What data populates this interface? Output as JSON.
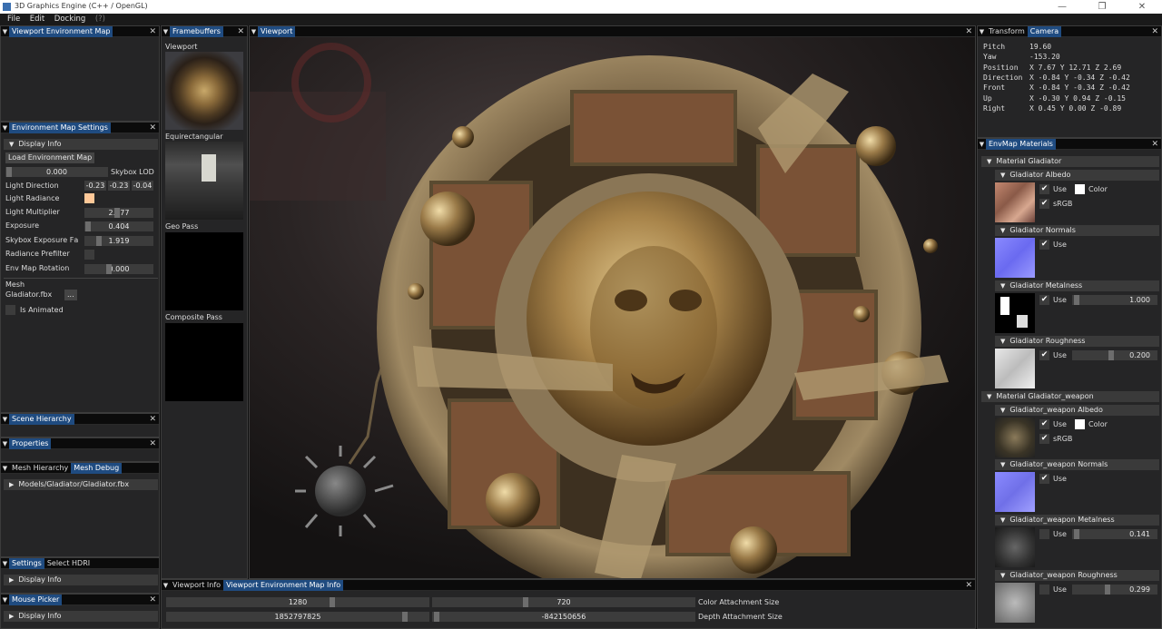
{
  "window": {
    "title": "3D Graphics Engine (C++ / OpenGL)",
    "minimize": "—",
    "restore": "❐",
    "close": "✕"
  },
  "menu": {
    "file": "File",
    "edit": "Edit",
    "docking": "Docking",
    "help": "(?)"
  },
  "env_map_panel": {
    "title": "Viewport Environment Map"
  },
  "env_settings": {
    "title": "Environment Map Settings",
    "display_info": "Display Info",
    "load_button": "Load Environment Map",
    "skybox_lod_value": "0.000",
    "skybox_lod_label": "Skybox LOD",
    "light_direction_label": "Light Direction",
    "light_direction_values": [
      "-0.23",
      "-0.23",
      "-0.04"
    ],
    "light_radiance_label": "Light Radiance",
    "light_radiance_color": "#ffc898",
    "light_multiplier_label": "Light Multiplier",
    "light_multiplier_value": "2.677",
    "exposure_label": "Exposure",
    "exposure_value": "0.404",
    "skybox_exposure_label": "Skybox Exposure Fа",
    "skybox_exposure_value": "1.919",
    "radiance_prefilter_label": "Radiance Prefilter",
    "env_rotation_label": "Env Map Rotation",
    "env_rotation_value": "0.000",
    "mesh_label": "Mesh",
    "mesh_file": "Gladiator.fbx",
    "mesh_browse": "...",
    "is_animated_label": "Is Animated"
  },
  "scene_hierarchy": {
    "title": "Scene Hierarchy"
  },
  "properties": {
    "title": "Properties"
  },
  "mesh_panel": {
    "tab1": "Mesh Hierarchy",
    "tab2": "Mesh Debug",
    "item": "Models/Gladiator/Gladiator.fbx"
  },
  "settings_panel": {
    "tab1": "Settings",
    "tab2": "Select HDRI",
    "display_info": "Display Info"
  },
  "mouse_picker": {
    "title": "Mouse Picker",
    "display_info": "Display Info"
  },
  "framebuffers": {
    "title": "Framebuffers",
    "viewport": "Viewport",
    "equirect": "Equirectangular",
    "geo": "Geo Pass",
    "composite": "Composite Pass"
  },
  "viewport": {
    "title": "Viewport"
  },
  "info_panel": {
    "tab1": "Viewport Info",
    "tab2": "Viewport Environment Map Info",
    "color_w": "1280",
    "color_h": "720",
    "color_label": "Color Attachment Size",
    "depth_w": "1852797825",
    "depth_h": "-842150656",
    "depth_label": "Depth Attachment Size"
  },
  "transform": {
    "tab1": "Transform",
    "tab2": "Camera",
    "rows": [
      {
        "label": "Pitch",
        "value": "19.60"
      },
      {
        "label": "Yaw",
        "value": "-153.20"
      },
      {
        "label": "Position",
        "value": "X 7.67 Y 12.71 Z 2.69"
      },
      {
        "label": "Direction",
        "value": "X -0.84 Y -0.34 Z -0.42"
      },
      {
        "label": "Front",
        "value": "X -0.84 Y -0.34 Z -0.42"
      },
      {
        "label": "Up",
        "value": "X -0.30 Y 0.94 Z -0.15"
      },
      {
        "label": "Right",
        "value": "X 0.45 Y 0.00 Z -0.89"
      }
    ]
  },
  "materials": {
    "title": "EnvMap Materials",
    "mat1": "Material Gladiator",
    "albedo": "Gladiator Albedo",
    "normals": "Gladiator Normals",
    "metalness": "Gladiator Metalness",
    "roughness": "Gladiator Roughness",
    "metal_value": "1.000",
    "rough_value": "0.200",
    "mat2": "Material Gladiator_weapon",
    "w_albedo": "Gladiator_weapon Albedo",
    "w_normals": "Gladiator_weapon Normals",
    "w_metalness": "Gladiator_weapon Metalness",
    "w_roughness": "Gladiator_weapon Roughness",
    "w_metal_value": "0.141",
    "w_rough_value": "0.299",
    "use": "Use",
    "color": "Color",
    "srgb": "sRGB"
  }
}
